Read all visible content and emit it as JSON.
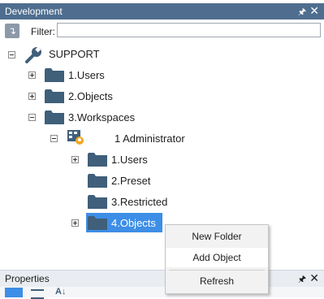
{
  "dev_panel": {
    "title": "Development",
    "pin": "ᵖ",
    "close": "✕"
  },
  "toolbar": {
    "filter_label": "Filter:",
    "filter_value": ""
  },
  "tree": {
    "root": "SUPPORT",
    "users": "1.Users",
    "objects": "2.Objects",
    "workspaces": "3.Workspaces",
    "admin": "1 Administrator",
    "admin_users": "1.Users",
    "preset": "2.Preset",
    "restricted": "3.Restricted",
    "admin_objects": "4.Objects"
  },
  "context_menu": {
    "items": [
      "New Folder",
      "Add Object",
      "Refresh"
    ]
  },
  "props_panel": {
    "title": "Properties",
    "pin": "ᵖ",
    "close": "✕"
  },
  "colors": {
    "title_bar": "#4f6e8f",
    "selection": "#3d8ee6",
    "folder": "#3f5f7a"
  }
}
